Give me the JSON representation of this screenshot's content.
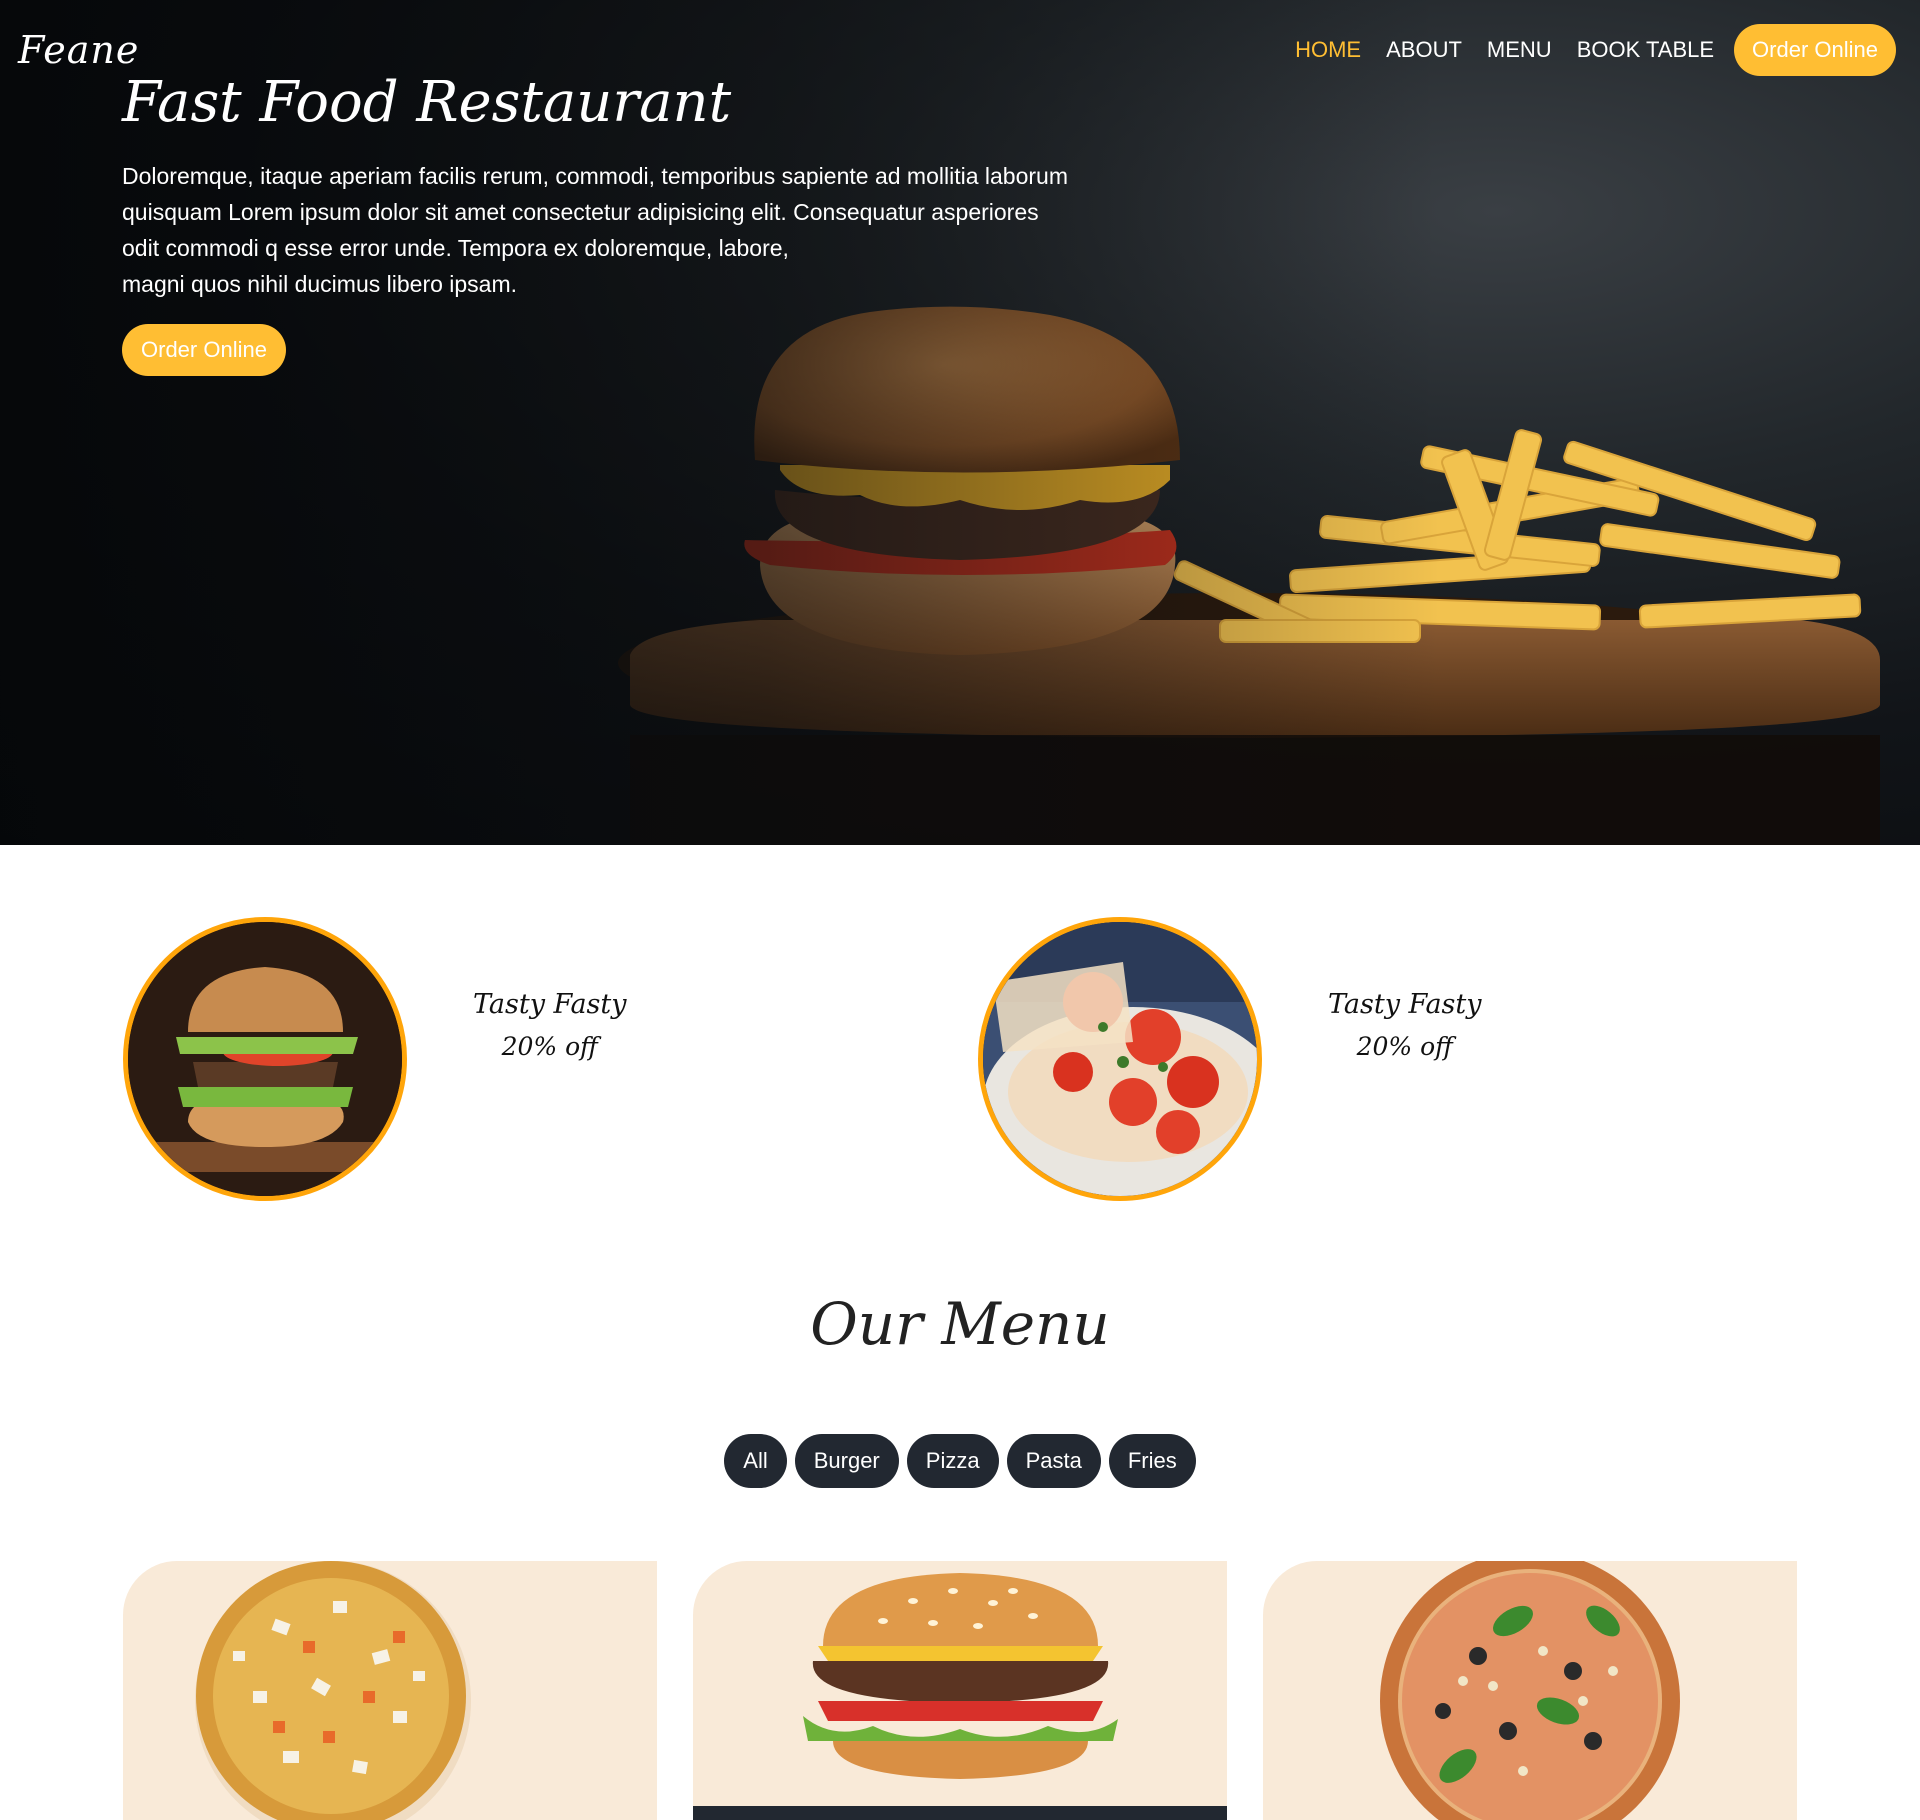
{
  "header": {
    "brand": "Feane",
    "nav": [
      {
        "label": "HOME",
        "active": true
      },
      {
        "label": "ABOUT",
        "active": false
      },
      {
        "label": "MENU",
        "active": false
      },
      {
        "label": "BOOK TABLE",
        "active": false
      }
    ],
    "order_label": "Order Online"
  },
  "hero": {
    "title": "Fast Food Restaurant",
    "text_lines": [
      "Doloremque, itaque aperiam facilis rerum, commodi, temporibus sapiente ad mollitia laborum",
      "quisquam Lorem ipsum dolor sit amet consectetur adipisicing elit. Consequatur asperiores",
      "odit commodi q esse error unde. Tempora ex doloremque, labore,",
      "magni quos nihil ducimus libero ipsam."
    ],
    "button_label": "Order Online",
    "image": "burger-and-fries-on-wooden-board"
  },
  "offers": [
    {
      "title": "Tasty Fasty",
      "discount": "20% off",
      "image": "stacked-burger"
    },
    {
      "title": "Tasty Fasty",
      "discount": "20% off",
      "image": "pizza-slice"
    }
  ],
  "menu": {
    "title": "Our Menu",
    "filters": [
      "All",
      "Burger",
      "Pizza",
      "Pasta",
      "Fries"
    ],
    "items": [
      {
        "image": "pizza-onion-carrot"
      },
      {
        "image": "cheeseburger"
      },
      {
        "image": "pizza-olive-basil"
      }
    ]
  },
  "colors": {
    "accent": "#ffbe33",
    "offer_ring": "#ffa50a",
    "dark": "#222831",
    "card_bg": "#f9ead8"
  }
}
